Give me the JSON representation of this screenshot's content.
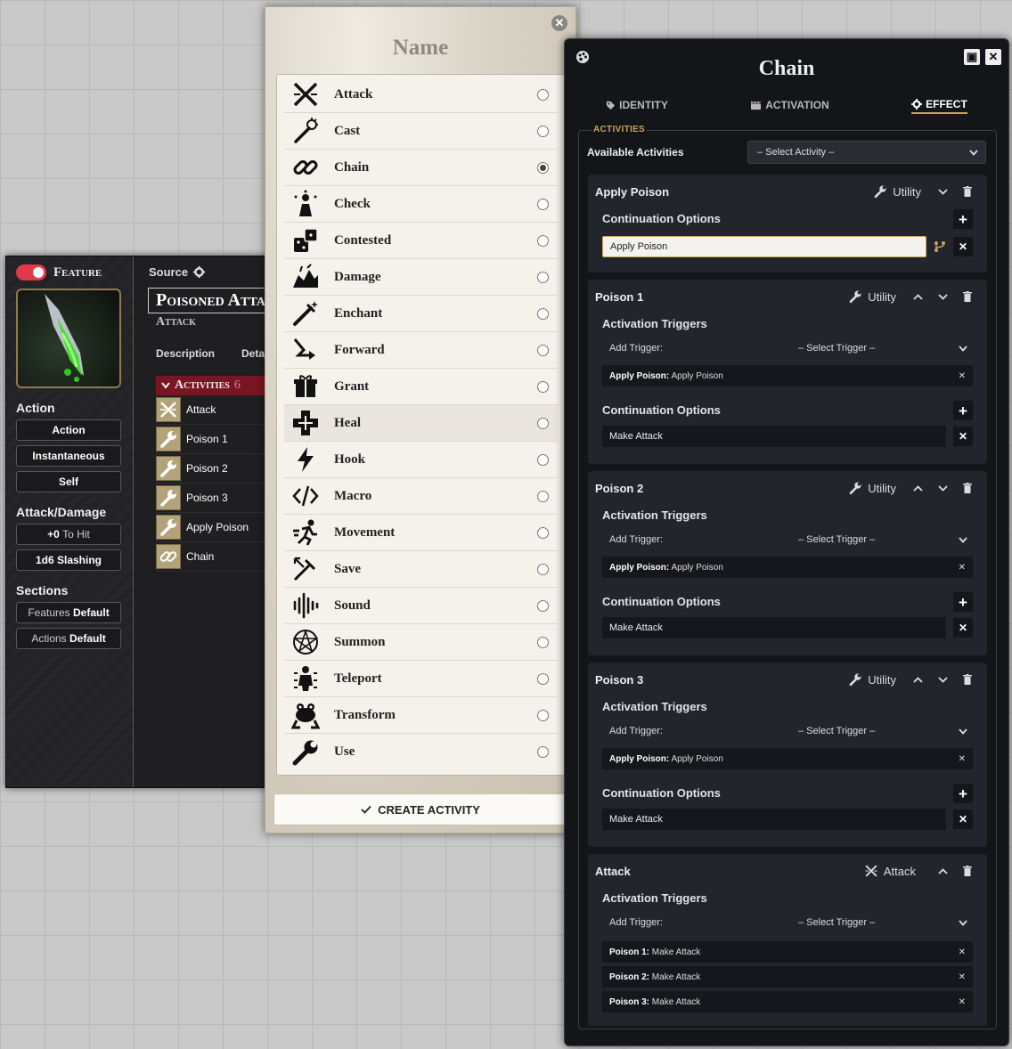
{
  "sheet": {
    "feature_label": "Feature",
    "source_label": "Source",
    "name": "Poisoned Attack",
    "subtitle": "Attack",
    "tabs": [
      "Description",
      "Details"
    ],
    "action_heading": "Action",
    "action_pills": [
      "Action",
      "Instantaneous",
      "Self"
    ],
    "attack_heading": "Attack/Damage",
    "to_hit_value": "+0",
    "to_hit_suffix": "To Hit",
    "damage": "1d6 Slashing",
    "sections_heading": "Sections",
    "sections": [
      {
        "name": "Features",
        "mode": "Default"
      },
      {
        "name": "Actions",
        "mode": "Default"
      }
    ],
    "activities_header": "Activities",
    "activities_count": "6",
    "activities": [
      {
        "label": "Attack",
        "icon": "attack-icon"
      },
      {
        "label": "Poison 1",
        "icon": "wrench-icon"
      },
      {
        "label": "Poison 2",
        "icon": "wrench-icon"
      },
      {
        "label": "Poison 3",
        "icon": "wrench-icon"
      },
      {
        "label": "Apply Poison",
        "icon": "wrench-icon"
      },
      {
        "label": "Chain",
        "icon": "chain-icon"
      }
    ]
  },
  "dialog": {
    "title": "Name",
    "close": "✕",
    "types": [
      {
        "label": "Attack",
        "icon": "crossed-swords-icon",
        "selected": false
      },
      {
        "label": "Cast",
        "icon": "wand-icon",
        "selected": false
      },
      {
        "label": "Chain",
        "icon": "chain-link-icon",
        "selected": true
      },
      {
        "label": "Check",
        "icon": "check-icon",
        "selected": false
      },
      {
        "label": "Contested",
        "icon": "dice-icon",
        "selected": false
      },
      {
        "label": "Damage",
        "icon": "damage-icon",
        "selected": false
      },
      {
        "label": "Enchant",
        "icon": "enchant-icon",
        "selected": false
      },
      {
        "label": "Forward",
        "icon": "forward-icon",
        "selected": false
      },
      {
        "label": "Grant",
        "icon": "grant-icon",
        "selected": false
      },
      {
        "label": "Heal",
        "icon": "heal-icon",
        "selected": false
      },
      {
        "label": "Hook",
        "icon": "lightning-icon",
        "selected": false
      },
      {
        "label": "Macro",
        "icon": "code-icon",
        "selected": false
      },
      {
        "label": "Movement",
        "icon": "running-icon",
        "selected": false
      },
      {
        "label": "Save",
        "icon": "save-icon",
        "selected": false
      },
      {
        "label": "Sound",
        "icon": "sound-icon",
        "selected": false
      },
      {
        "label": "Summon",
        "icon": "pentagram-icon",
        "selected": false
      },
      {
        "label": "Teleport",
        "icon": "teleport-icon",
        "selected": false
      },
      {
        "label": "Transform",
        "icon": "frog-icon",
        "selected": false
      },
      {
        "label": "Use",
        "icon": "wrench-icon",
        "selected": false
      }
    ],
    "highlighted": "Heal",
    "create_label": "CREATE ACTIVITY"
  },
  "chain": {
    "title": "Chain",
    "tabs": [
      "IDENTITY",
      "ACTIVATION",
      "EFFECT"
    ],
    "active_tab": "EFFECT",
    "activities_legend": "ACTIVITIES",
    "available_label": "Available Activities",
    "select_activity": "– Select Activity –",
    "activation_triggers_label": "Activation Triggers",
    "continuation_label": "Continuation Options",
    "add_trigger_label": "Add Trigger:",
    "select_trigger": "– Select Trigger –",
    "apply_poison": {
      "title": "Apply Poison",
      "type": "Utility",
      "continuation_value": "Apply Poison"
    },
    "poison1": {
      "title": "Poison 1",
      "type": "Utility",
      "trigger_source": "Apply Poison:",
      "trigger_target": "Apply Poison",
      "continuation_value": "Make Attack"
    },
    "poison2": {
      "title": "Poison 2",
      "type": "Utility",
      "trigger_source": "Apply Poison:",
      "trigger_target": "Apply Poison",
      "continuation_value": "Make Attack"
    },
    "poison3": {
      "title": "Poison 3",
      "type": "Utility",
      "trigger_source": "Apply Poison:",
      "trigger_target": "Apply Poison",
      "continuation_value": "Make Attack"
    },
    "attack": {
      "title": "Attack",
      "type": "Attack",
      "triggers": [
        {
          "source": "Poison 1:",
          "target": "Make Attack"
        },
        {
          "source": "Poison 2:",
          "target": "Make Attack"
        },
        {
          "source": "Poison 3:",
          "target": "Make Attack"
        }
      ]
    }
  }
}
